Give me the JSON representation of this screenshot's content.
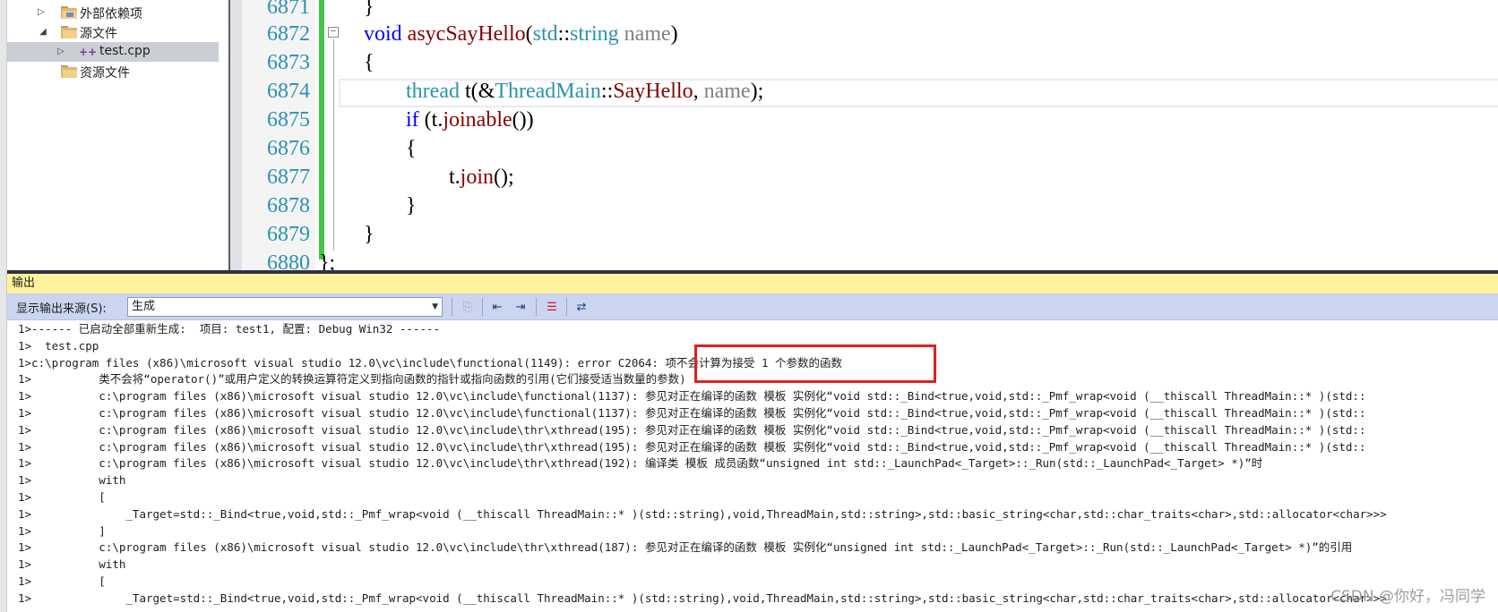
{
  "explorer": {
    "items": [
      {
        "label": "外部依赖项",
        "expander": "▷"
      },
      {
        "label": "源文件",
        "expander": "◢"
      },
      {
        "label": "test.cpp",
        "expander": "▷",
        "icon_text": "++"
      },
      {
        "label": "资源文件",
        "expander": ""
      }
    ]
  },
  "editor": {
    "line_numbers": [
      "6871",
      "6872",
      "6873",
      "6874",
      "6875",
      "6876",
      "6877",
      "6878",
      "6879",
      "6880"
    ],
    "outline_symbol": "−",
    "lines": [
      {
        "tokens": [
          {
            "t": "}",
            "c": ""
          }
        ]
      },
      {
        "tokens": [
          {
            "t": "void",
            "c": "kw"
          },
          {
            "t": " ",
            "c": ""
          },
          {
            "t": "asycSayHello",
            "c": "fn"
          },
          {
            "t": "(",
            "c": ""
          },
          {
            "t": "std",
            "c": "ty"
          },
          {
            "t": "::",
            "c": ""
          },
          {
            "t": "string",
            "c": "ty"
          },
          {
            "t": " ",
            "c": ""
          },
          {
            "t": "name",
            "c": "param"
          },
          {
            "t": ")",
            "c": ""
          }
        ]
      },
      {
        "tokens": [
          {
            "t": "{",
            "c": ""
          }
        ]
      },
      {
        "tokens": [
          {
            "t": "thread",
            "c": "ty"
          },
          {
            "t": " t(&",
            "c": ""
          },
          {
            "t": "ThreadMain",
            "c": "ty"
          },
          {
            "t": "::",
            "c": ""
          },
          {
            "t": "SayHello",
            "c": "fn"
          },
          {
            "t": ", ",
            "c": ""
          },
          {
            "t": "name",
            "c": "param"
          },
          {
            "t": ");",
            "c": ""
          }
        ]
      },
      {
        "tokens": [
          {
            "t": "if",
            "c": "kw"
          },
          {
            "t": " (t.",
            "c": ""
          },
          {
            "t": "joinable",
            "c": "fn"
          },
          {
            "t": "())",
            "c": ""
          }
        ]
      },
      {
        "tokens": [
          {
            "t": "{",
            "c": ""
          }
        ]
      },
      {
        "tokens": [
          {
            "t": "t.",
            "c": ""
          },
          {
            "t": "join",
            "c": "fn"
          },
          {
            "t": "();",
            "c": ""
          }
        ]
      },
      {
        "tokens": [
          {
            "t": "}",
            "c": ""
          }
        ]
      },
      {
        "tokens": [
          {
            "t": "}",
            "c": ""
          }
        ]
      },
      {
        "tokens": [
          {
            "t": "};",
            "c": ""
          }
        ]
      }
    ]
  },
  "output": {
    "title": "输出",
    "source_label": "显示输出来源(S):",
    "source_value": "生成",
    "lines": [
      "1>------ 已启动全部重新生成:  项目: test1, 配置: Debug Win32 ------",
      "1>  test.cpp",
      "1>c:\\program files (x86)\\microsoft visual studio 12.0\\vc\\include\\functional(1149): error C2064: 项不会计算为接受 1 个参数的函数",
      "1>          类不会将“operator()”或用户定义的转换运算符定义到指向函数的指针或指向函数的引用(它们接受适当数量的参数)",
      "1>          c:\\program files (x86)\\microsoft visual studio 12.0\\vc\\include\\functional(1137): 参见对正在编译的函数 模板 实例化“void std::_Bind<true,void,std::_Pmf_wrap<void (__thiscall ThreadMain::* )(std::",
      "1>          c:\\program files (x86)\\microsoft visual studio 12.0\\vc\\include\\functional(1137): 参见对正在编译的函数 模板 实例化“void std::_Bind<true,void,std::_Pmf_wrap<void (__thiscall ThreadMain::* )(std::",
      "1>          c:\\program files (x86)\\microsoft visual studio 12.0\\vc\\include\\thr\\xthread(195): 参见对正在编译的函数 模板 实例化“void std::_Bind<true,void,std::_Pmf_wrap<void (__thiscall ThreadMain::* )(std::",
      "1>          c:\\program files (x86)\\microsoft visual studio 12.0\\vc\\include\\thr\\xthread(195): 参见对正在编译的函数 模板 实例化“void std::_Bind<true,void,std::_Pmf_wrap<void (__thiscall ThreadMain::* )(std::",
      "1>          c:\\program files (x86)\\microsoft visual studio 12.0\\vc\\include\\thr\\xthread(192): 编译类 模板 成员函数“unsigned int std::_LaunchPad<_Target>::_Run(std::_LaunchPad<_Target> *)”时",
      "1>          with",
      "1>          [",
      "1>              _Target=std::_Bind<true,void,std::_Pmf_wrap<void (__thiscall ThreadMain::* )(std::string),void,ThreadMain,std::string>,std::basic_string<char,std::char_traits<char>,std::allocator<char>>>",
      "1>          ]",
      "1>          c:\\program files (x86)\\microsoft visual studio 12.0\\vc\\include\\thr\\xthread(187): 参见对正在编译的函数 模板 实例化“unsigned int std::_LaunchPad<_Target>::_Run(std::_LaunchPad<_Target> *)”的引用",
      "1>          with",
      "1>          [",
      "1>              _Target=std::_Bind<true,void,std::_Pmf_wrap<void (__thiscall ThreadMain::* )(std::string),void,ThreadMain,std::string>,std::basic_string<char,std::char_traits<char>,std::allocator<char>>>"
    ]
  },
  "watermark": "CSDN @你好，冯同学"
}
